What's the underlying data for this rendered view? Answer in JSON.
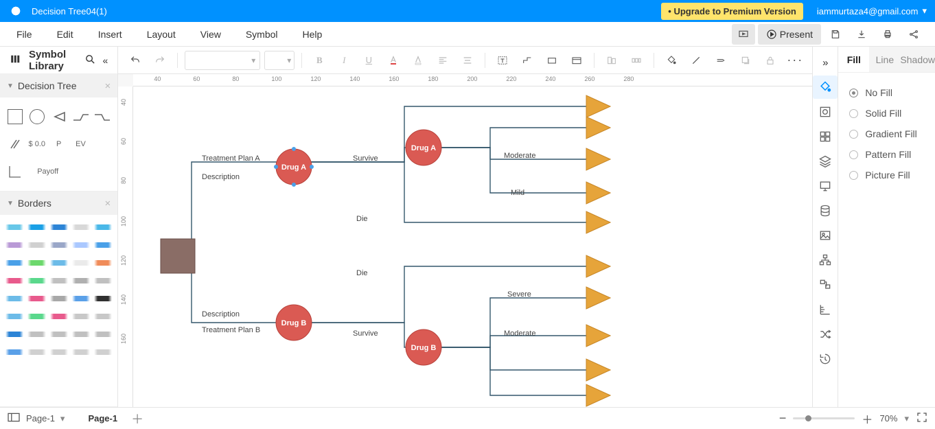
{
  "titlebar": {
    "title": "Decision Tree04(1)",
    "upgrade": "• Upgrade to Premium Version",
    "account": "iammurtaza4@gmail.com"
  },
  "menu": [
    "File",
    "Edit",
    "Insert",
    "Layout",
    "View",
    "Symbol",
    "Help"
  ],
  "present": "Present",
  "symbol_library": {
    "title": "Symbol Library"
  },
  "sections": {
    "decision_tree": "Decision Tree",
    "borders": "Borders"
  },
  "shapes": {
    "dollar": "$ 0.0",
    "p": "P",
    "ev": "EV",
    "payoff": "Payoff"
  },
  "right_tabs": [
    "Fill",
    "Line",
    "Shadow"
  ],
  "fill_options": [
    "No Fill",
    "Solid Fill",
    "Gradient Fill",
    "Pattern Fill",
    "Picture Fill"
  ],
  "status": {
    "page_select": "Page-1",
    "page_tab": "Page-1",
    "zoom": "70%"
  },
  "ruler_h": [
    "40",
    "60",
    "80",
    "100",
    "120",
    "140",
    "160",
    "180",
    "200",
    "220",
    "240",
    "260",
    "280"
  ],
  "ruler_v": [
    "40",
    "60",
    "80",
    "100",
    "120",
    "140",
    "160"
  ],
  "diagram": {
    "root_labels": {
      "plan_a": "Treatment Plan A",
      "desc_a": "Description",
      "desc_b": "Description",
      "plan_b": "Treatment Plan B"
    },
    "node_a": "Drug A",
    "node_b": "Drug  B",
    "node_a2": "Drug A",
    "node_b2": "Drug  B",
    "labels": {
      "survive_a": "Survive",
      "die_a": "Die",
      "moderate_a": "Moderate",
      "mild": "Mild",
      "die_b": "Die",
      "severe": "Severe",
      "moderate_b": "Moderate",
      "survive_b": "Survive"
    }
  },
  "border_colors": [
    "#67c7e8",
    "#1aa0e6",
    "#2c84d6",
    "#d8d8d8",
    "#4ab8e8",
    "#b99ad6",
    "#d0d0d0",
    "#9aa7c8",
    "#aac8ff",
    "#4aa0e8",
    "#4aa0e8",
    "#6cd86c",
    "#6cbbe8",
    "#eaeaea",
    "#f08c5a",
    "#e85a8c",
    "#5ad88c",
    "#c0c0c0",
    "#b0b0b0",
    "#c0c0c0",
    "#6cbbe8",
    "#e85a8c",
    "#a8a8a8",
    "#5aa0e8",
    "#303030",
    "#6cbbe8",
    "#5ad88c",
    "#e85a8c",
    "#c8c8c8",
    "#c8c8c8",
    "#2c84d6",
    "#c0c0c0",
    "#c0c0c0",
    "#c0c0c0",
    "#c0c0c0",
    "#5aa0e8",
    "#d0d0d0",
    "#d0d0d0",
    "#d0d0d0",
    "#d0d0d0"
  ]
}
